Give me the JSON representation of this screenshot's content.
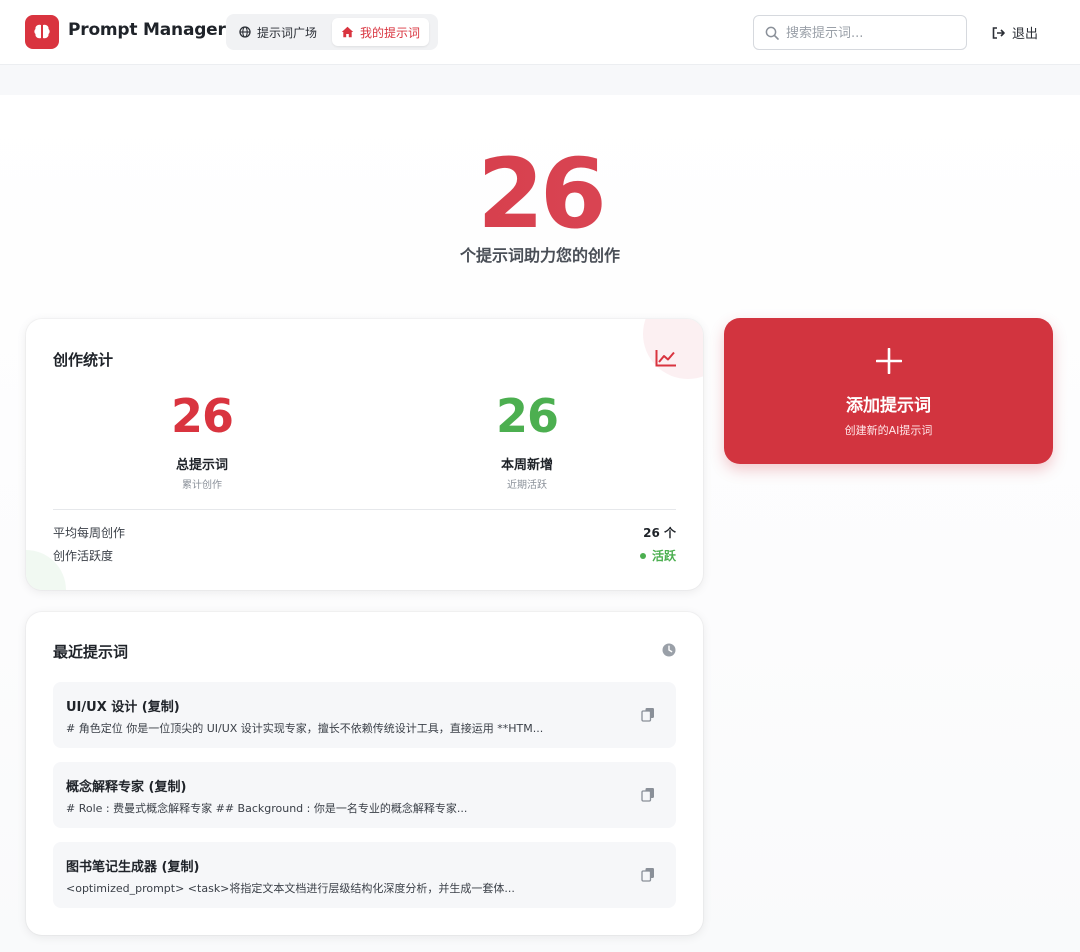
{
  "header": {
    "brand": "Prompt Manager",
    "tabs": [
      {
        "label": "提示词广场",
        "icon": "globe-icon",
        "active": false
      },
      {
        "label": "我的提示词",
        "icon": "home-icon",
        "active": true
      }
    ],
    "search_placeholder": "搜索提示词...",
    "logout_label": "退出"
  },
  "hero": {
    "count": "26",
    "subtitle": "个提示词助力您的创作"
  },
  "stats": {
    "title": "创作统计",
    "icon": "chart-line-icon",
    "total": {
      "value": "26",
      "label": "总提示词",
      "hint": "累计创作"
    },
    "weekly": {
      "value": "26",
      "label": "本周新增",
      "hint": "近期活跃"
    },
    "avg_label": "平均每周创作",
    "avg_value": "26 个",
    "activity_label": "创作活跃度",
    "activity_value": "活跃"
  },
  "add_card": {
    "title": "添加提示词",
    "subtitle": "创建新的AI提示词"
  },
  "recent": {
    "title": "最近提示词",
    "items": [
      {
        "title": "UI/UX 设计 (复制)",
        "desc": "# 角色定位 你是一位顶尖的 UI/UX 设计实现专家，擅长不依赖传统设计工具，直接运用 **HTM..."
      },
      {
        "title": "概念解释专家 (复制)",
        "desc": "# Role : 费曼式概念解释专家 ## Background : 你是一名专业的概念解释专家..."
      },
      {
        "title": "图书笔记生成器 (复制)",
        "desc": "<optimized_prompt> <task>将指定文本文档进行层级结构化深度分析，并生成一套体..."
      }
    ]
  },
  "colors": {
    "accent": "#d9343f",
    "success": "#4caf50",
    "muted_text": "#8a9099"
  }
}
